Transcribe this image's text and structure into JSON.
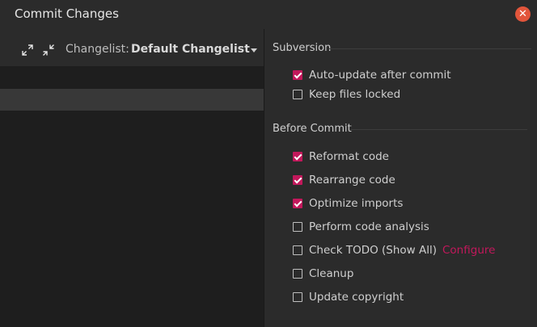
{
  "window": {
    "title": "Commit Changes"
  },
  "toolbar": {
    "expand_icon": "expand-all-icon",
    "collapse_icon": "collapse-all-icon",
    "changelist_label": "Changelist:",
    "changelist_value": "Default Changelist"
  },
  "subversion": {
    "title": "Subversion",
    "options": [
      {
        "label": "Auto-update after commit",
        "checked": true
      },
      {
        "label": "Keep files locked",
        "checked": false
      }
    ]
  },
  "before_commit": {
    "title": "Before Commit",
    "options": [
      {
        "label": "Reformat code",
        "checked": true
      },
      {
        "label": "Rearrange code",
        "checked": true
      },
      {
        "label": "Optimize imports",
        "checked": true
      },
      {
        "label": "Perform code analysis",
        "checked": false
      },
      {
        "label": "Check TODO (Show All)",
        "checked": false
      },
      {
        "label": "Cleanup",
        "checked": false
      },
      {
        "label": "Update copyright",
        "checked": false
      }
    ],
    "configure_link": "Configure"
  },
  "colors": {
    "accent": "#c2185b",
    "close": "#e2553b",
    "background": "#2b2b2b"
  }
}
